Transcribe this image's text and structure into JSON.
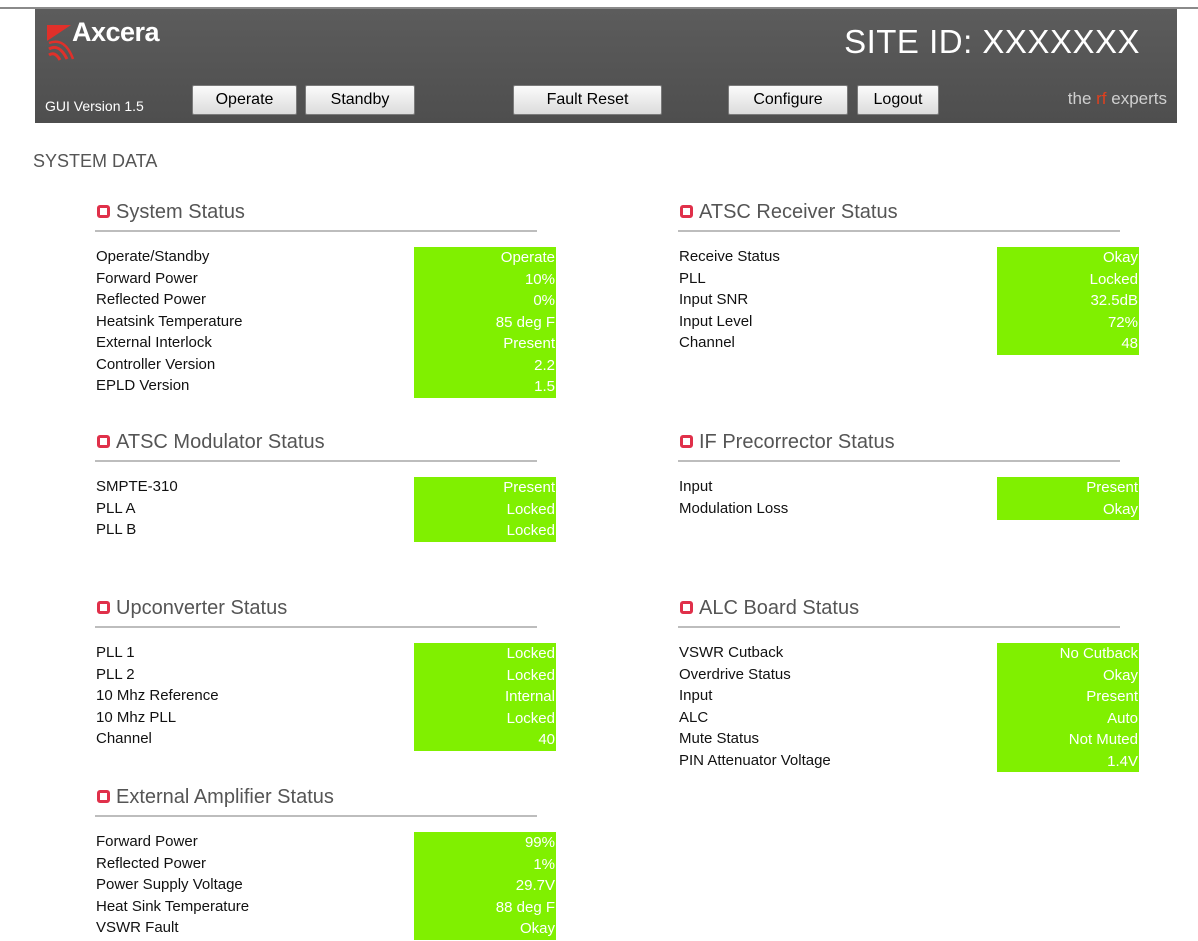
{
  "header": {
    "logo_text": "Axcera",
    "site_id": "SITE ID: XXXXXXX",
    "gui_version": "GUI Version 1.5",
    "buttons": {
      "operate": "Operate",
      "standby": "Standby",
      "fault_reset": "Fault Reset",
      "configure": "Configure",
      "logout": "Logout"
    },
    "tagline": {
      "prefix": "the ",
      "rf": "rf",
      "suffix": " experts"
    }
  },
  "page_title": "SYSTEM DATA",
  "colors": {
    "header_bg": "#555555",
    "value_bg": "#80f000",
    "value_text": "#ffffff",
    "section_icon": "#e0304a"
  },
  "sections": {
    "system_status": {
      "title": "System Status",
      "rows": [
        {
          "label": "Operate/Standby",
          "value": "Operate"
        },
        {
          "label": "Forward Power",
          "value": "10%"
        },
        {
          "label": "Reflected Power",
          "value": "0%"
        },
        {
          "label": "Heatsink Temperature",
          "value": "85 deg F"
        },
        {
          "label": "External Interlock",
          "value": "Present"
        },
        {
          "label": "Controller Version",
          "value": "2.2"
        },
        {
          "label": "EPLD Version",
          "value": "1.5"
        }
      ]
    },
    "atsc_receiver": {
      "title": "ATSC Receiver Status",
      "rows": [
        {
          "label": "Receive Status",
          "value": "Okay"
        },
        {
          "label": "PLL",
          "value": "Locked"
        },
        {
          "label": "Input SNR",
          "value": "32.5dB"
        },
        {
          "label": "Input Level",
          "value": "72%"
        },
        {
          "label": "Channel",
          "value": "48"
        }
      ]
    },
    "atsc_modulator": {
      "title": "ATSC Modulator Status",
      "rows": [
        {
          "label": "SMPTE-310",
          "value": "Present"
        },
        {
          "label": "PLL A",
          "value": "Locked"
        },
        {
          "label": "PLL B",
          "value": "Locked"
        }
      ]
    },
    "if_precorrector": {
      "title": "IF Precorrector Status",
      "rows": [
        {
          "label": "Input",
          "value": "Present"
        },
        {
          "label": "Modulation Loss",
          "value": "Okay"
        }
      ]
    },
    "upconverter": {
      "title": "Upconverter Status",
      "rows": [
        {
          "label": "PLL 1",
          "value": "Locked"
        },
        {
          "label": "PLL 2",
          "value": "Locked"
        },
        {
          "label": "10 Mhz Reference",
          "value": "Internal"
        },
        {
          "label": "10 Mhz PLL",
          "value": "Locked"
        },
        {
          "label": "Channel",
          "value": "40"
        }
      ]
    },
    "alc_board": {
      "title": "ALC Board Status",
      "rows": [
        {
          "label": "VSWR Cutback",
          "value": "No Cutback"
        },
        {
          "label": "Overdrive Status",
          "value": "Okay"
        },
        {
          "label": "Input",
          "value": "Present"
        },
        {
          "label": "ALC",
          "value": "Auto"
        },
        {
          "label": "Mute Status",
          "value": "Not Muted"
        },
        {
          "label": "PIN Attenuator Voltage",
          "value": "1.4V"
        }
      ]
    },
    "external_amplifier": {
      "title": "External Amplifier Status",
      "rows": [
        {
          "label": "Forward Power",
          "value": "99%"
        },
        {
          "label": "Reflected Power",
          "value": "1%"
        },
        {
          "label": "Power Supply Voltage",
          "value": "29.7V"
        },
        {
          "label": "Heat Sink Temperature",
          "value": "88 deg F"
        },
        {
          "label": "VSWR Fault",
          "value": "Okay"
        }
      ]
    }
  }
}
